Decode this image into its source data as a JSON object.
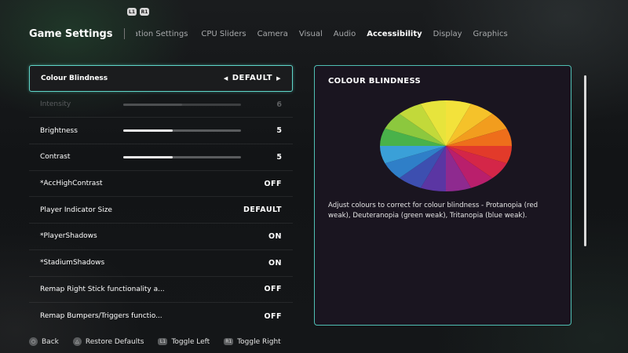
{
  "shoulder_hints": {
    "left": "L1",
    "right": "R1"
  },
  "header": {
    "title": "Game Settings",
    "tabs": [
      {
        "label": "Simulation Settings",
        "state": "partial"
      },
      {
        "label": "CPU Sliders"
      },
      {
        "label": "Camera"
      },
      {
        "label": "Visual"
      },
      {
        "label": "Audio"
      },
      {
        "label": "Accessibility",
        "active": true
      },
      {
        "label": "Display"
      },
      {
        "label": "Graphics"
      }
    ]
  },
  "settings": [
    {
      "label": "Colour Blindness",
      "value": "DEFAULT",
      "selected": true
    },
    {
      "label": "Intensity",
      "value": "6",
      "fraction": 0.5,
      "disabled": true
    },
    {
      "label": "Brightness",
      "value": "5",
      "fraction": 0.42
    },
    {
      "label": "Contrast",
      "value": "5",
      "fraction": 0.42
    },
    {
      "label": "*AccHighContrast",
      "value": "OFF"
    },
    {
      "label": "Player Indicator Size",
      "value": "DEFAULT"
    },
    {
      "label": "*PlayerShadows",
      "value": "ON"
    },
    {
      "label": "*StadiumShadows",
      "value": "ON"
    },
    {
      "label": "Remap Right Stick functionality a...",
      "value": "OFF"
    },
    {
      "label": "Remap Bumpers/Triggers functio...",
      "value": "OFF"
    }
  ],
  "info_panel": {
    "title": "COLOUR BLINDNESS",
    "description": "Adjust colours to correct for colour blindness - Protanopia (red weak), Deuteranopia (green weak), Tritanopia (blue weak).",
    "wheel_colors": [
      "#f3e23b",
      "#f5c22a",
      "#f29d1e",
      "#ee6e1b",
      "#e23a2a",
      "#d42648",
      "#b91f6c",
      "#8e2a8f",
      "#5b36a3",
      "#3d4fb0",
      "#2f7fc8",
      "#3aa0d8",
      "#49b24a",
      "#8cc83e",
      "#c2d93a",
      "#e7e43c"
    ]
  },
  "footer": [
    {
      "icon": "circle-button-icon",
      "label": "Back"
    },
    {
      "icon": "triangle-button-icon",
      "label": "Restore Defaults"
    },
    {
      "icon": "l1-button-icon",
      "glyph": "L1",
      "label": "Toggle Left"
    },
    {
      "icon": "r1-button-icon",
      "glyph": "R1",
      "label": "Toggle Right"
    }
  ]
}
